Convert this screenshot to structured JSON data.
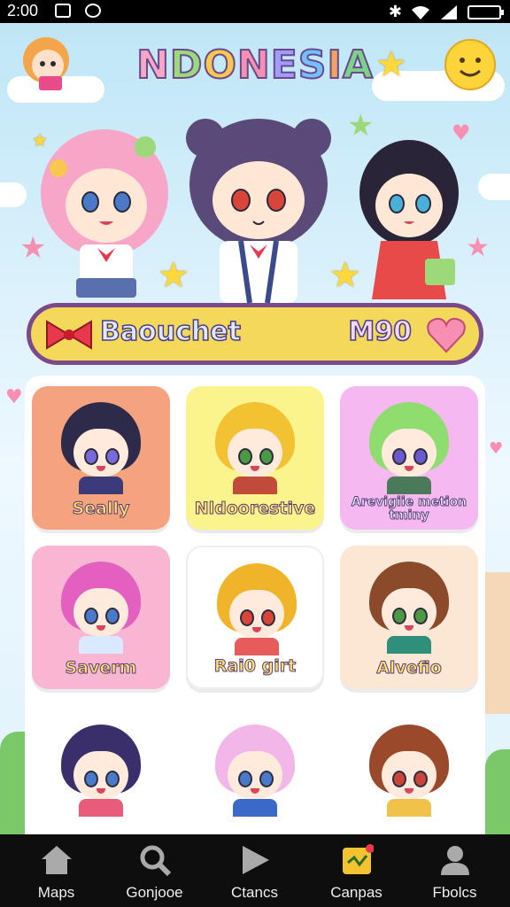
{
  "status_bar": {
    "time": "2:00"
  },
  "title": {
    "letters": [
      "N",
      "D",
      "O",
      "N",
      "E",
      "S",
      "I",
      "A"
    ],
    "colors": [
      "#f7a6c8",
      "#9bd97a",
      "#f9c74f",
      "#f78fb3",
      "#a29bfe",
      "#74c0fc",
      "#f4a261",
      "#7bd389"
    ]
  },
  "banner": {
    "label": "Baouchet",
    "count": "M90"
  },
  "cards": [
    {
      "name": "Seally",
      "bg": "#f5a27e",
      "hair": "#2e2a4a",
      "eye": "#7a6ad9",
      "body": "#3b3b7a"
    },
    {
      "name": "Nldoorestive",
      "bg": "#fbf48c",
      "hair": "#f2c233",
      "eye": "#4a9a44",
      "body": "#c14a3a"
    },
    {
      "name": "Arevigiie metion tminy",
      "bg": "#f5b8f0",
      "hair": "#8fdc6f",
      "eye": "#6a5acd",
      "body": "#4a7a5a"
    },
    {
      "name": "Saverm",
      "bg": "#f9b6d2",
      "hair": "#e35fc0",
      "eye": "#4a79c9",
      "body": "#d9e9ff"
    },
    {
      "name": "Rai0 girt",
      "bg": "#ffffff",
      "hair": "#f0b42a",
      "eye": "#d9453a",
      "body": "#e85b5b"
    },
    {
      "name": "Alvefio",
      "bg": "#fbe7d3",
      "hair": "#8b4a2a",
      "eye": "#4a9a44",
      "body": "#2f8f7a"
    },
    {
      "name": "",
      "bg": "#ffffff",
      "hair": "#3a2f6a",
      "eye": "#4a79c9",
      "body": "#e85b7b"
    },
    {
      "name": "",
      "bg": "#ffffff",
      "hair": "#f3b6e8",
      "eye": "#4a79c9",
      "body": "#3a6ac9"
    },
    {
      "name": "",
      "bg": "#ffffff",
      "hair": "#9a4a2a",
      "eye": "#c9453a",
      "body": "#f0c24a"
    }
  ],
  "tabs": [
    {
      "label": "Maps",
      "icon": "home-icon"
    },
    {
      "label": "Gonjooe",
      "icon": "search-icon"
    },
    {
      "label": "Ctancs",
      "icon": "play-icon"
    },
    {
      "label": "Canpas",
      "icon": "sticker-icon"
    },
    {
      "label": "Fbolcs",
      "icon": "person-icon"
    }
  ]
}
